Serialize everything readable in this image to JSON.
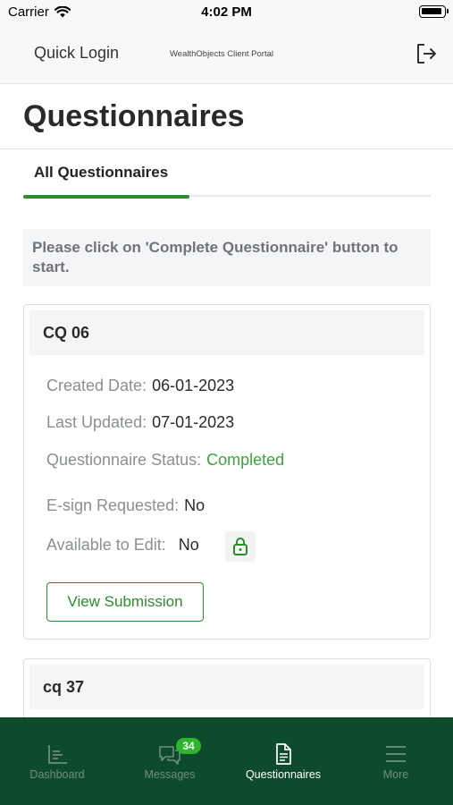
{
  "status_bar": {
    "carrier": "Carrier",
    "time": "4:02 PM"
  },
  "header": {
    "quick_login": "Quick Login",
    "portal_name": "WealthObjects Client Portal",
    "logout_icon": "logout-icon"
  },
  "page": {
    "title": "Questionnaires"
  },
  "tabs": [
    {
      "label": "All Questionnaires",
      "active": true
    }
  ],
  "banner": {
    "text": "Please click on 'Complete Questionnaire' button to start."
  },
  "cards": [
    {
      "title": "CQ 06",
      "created_label": "Created Date:",
      "created_value": "06-01-2023",
      "updated_label": "Last Updated:",
      "updated_value": "07-01-2023",
      "status_label": "Questionnaire Status:",
      "status_value": "Completed",
      "esign_label": "E-sign Requested:",
      "esign_value": "No",
      "edit_label": "Available to Edit:",
      "edit_value": "No",
      "button_label": "View Submission"
    },
    {
      "title": "cq 37"
    }
  ],
  "bottom_nav": {
    "items": [
      {
        "label": "Dashboard",
        "icon": "dashboard-icon"
      },
      {
        "label": "Messages",
        "icon": "messages-icon",
        "badge": "34"
      },
      {
        "label": "Questionnaires",
        "icon": "document-icon",
        "active": true
      },
      {
        "label": "More",
        "icon": "menu-icon"
      }
    ]
  },
  "colors": {
    "accent": "#2e8b2e",
    "nav_background": "#0e4a2c",
    "status_completed": "#3aa53a",
    "badge": "#2db52d"
  }
}
